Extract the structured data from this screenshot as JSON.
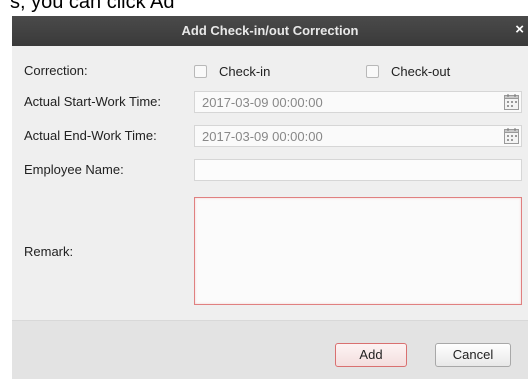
{
  "background_text": "s, you can click Ad",
  "dialog": {
    "title": "Add Check-in/out Correction",
    "close_glyph": "×"
  },
  "form": {
    "correction_label": "Correction:",
    "checkin_label": "Check-in",
    "checkout_label": "Check-out",
    "checkin_checked": false,
    "checkout_checked": false,
    "start_label": "Actual Start-Work Time:",
    "start_value": "2017-03-09 00:00:00",
    "end_label": "Actual End-Work Time:",
    "end_value": "2017-03-09 00:00:00",
    "employee_label": "Employee Name:",
    "employee_value": "",
    "remark_label": "Remark:",
    "remark_value": ""
  },
  "buttons": {
    "add_label": "Add",
    "cancel_label": "Cancel"
  },
  "icons": {
    "calendar": "calendar-icon",
    "close": "close-icon"
  },
  "colors": {
    "titlebar": "#3f3f3f",
    "accent_invalid": "#e08080",
    "body": "#efefef"
  }
}
